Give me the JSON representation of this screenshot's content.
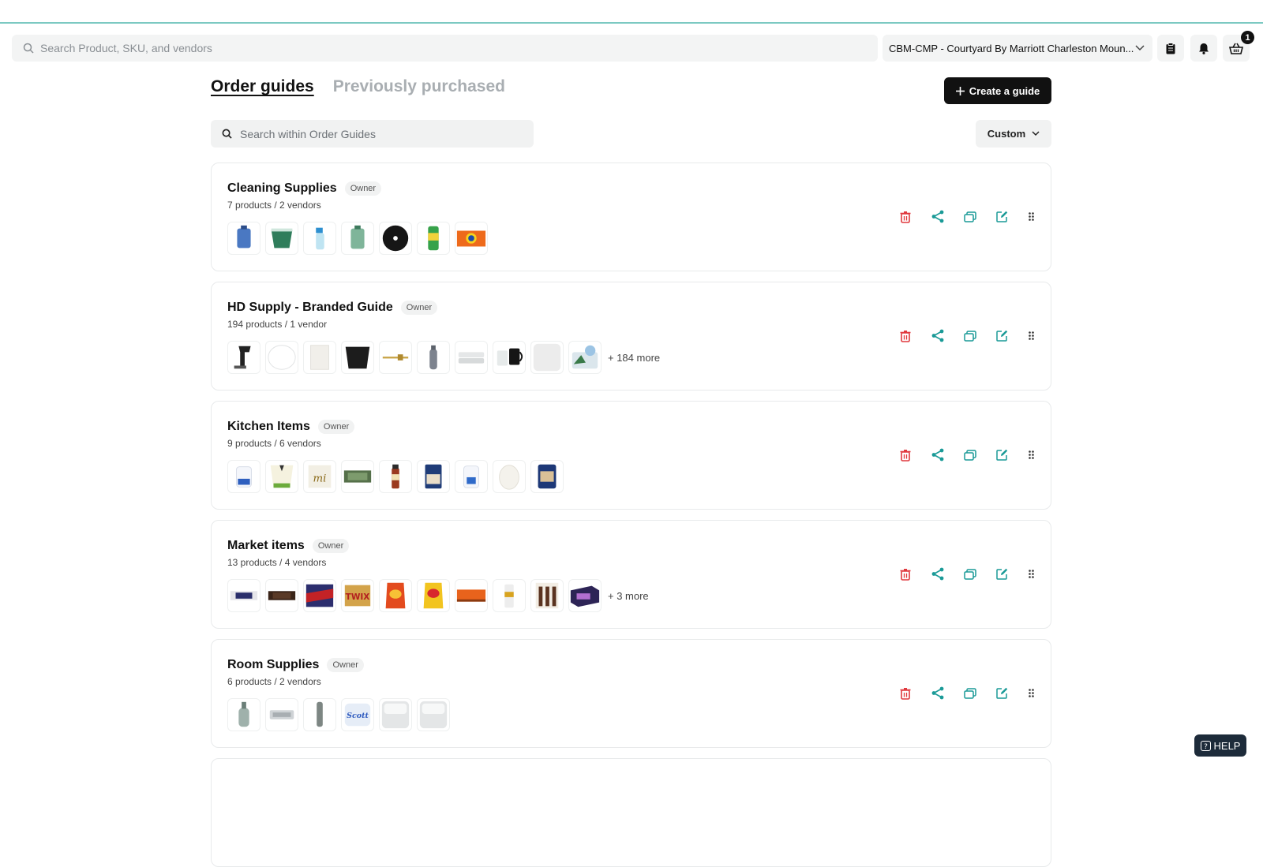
{
  "topbar": {
    "search_placeholder": "Search Product, SKU, and vendors",
    "location": "CBM-CMP - Courtyard By Marriott Charleston Moun...",
    "cart_count": "1"
  },
  "tabs": [
    {
      "label": "Order guides",
      "active": true
    },
    {
      "label": "Previously purchased",
      "active": false
    }
  ],
  "create_button": "Create a guide",
  "guide_search_placeholder": "Search within Order Guides",
  "sort_label": "Custom",
  "guides": [
    {
      "title": "Cleaning Supplies",
      "badge": "Owner",
      "meta": "7 products / 2 vendors",
      "thumbs": [
        "jug-blue",
        "bucket-green",
        "spray-bottle",
        "jug-green",
        "pad-black",
        "paper-towel",
        "tide-box"
      ],
      "more": ""
    },
    {
      "title": "HD Supply - Branded Guide",
      "badge": "Owner",
      "meta": "194 products / 1 vendor",
      "thumbs": [
        "steamer",
        "plate-white",
        "bag-paper",
        "waste-bin",
        "rod-brass",
        "bottle-gray",
        "towels-stack",
        "mugs",
        "liner-white",
        "bin-plants"
      ],
      "more": "+ 184 more"
    },
    {
      "title": "Kitchen Items",
      "badge": "Owner",
      "meta": "9 products / 6 vendors",
      "thumbs": [
        "jug-milk",
        "tea-box",
        "mi-box",
        "flat-pack",
        "sauce-bottle",
        "goya-can",
        "milk-gallon",
        "egg",
        "snack-bag"
      ],
      "more": ""
    },
    {
      "title": "Market items",
      "badge": "Owner",
      "meta": "13 products / 4 vendors",
      "thumbs": [
        "hersheys-bar",
        "hersheys-bar-dark",
        "candy-box",
        "twix",
        "chips-red",
        "chips-yellow",
        "reeses-box",
        "drink-can",
        "cookie-bars",
        "kind-box"
      ],
      "more": "+ 3 more"
    },
    {
      "title": "Room Supplies",
      "badge": "Owner",
      "meta": "6 products / 2 vendors",
      "thumbs": [
        "bottle-soap",
        "soap-bar",
        "tube-gray",
        "scott-roll",
        "tray-white",
        "tray-white-2"
      ],
      "more": ""
    }
  ],
  "help_label": "HELP",
  "colors": {
    "trash": "#e0393e",
    "teal": "#1a9a97",
    "dark": "#111111"
  }
}
